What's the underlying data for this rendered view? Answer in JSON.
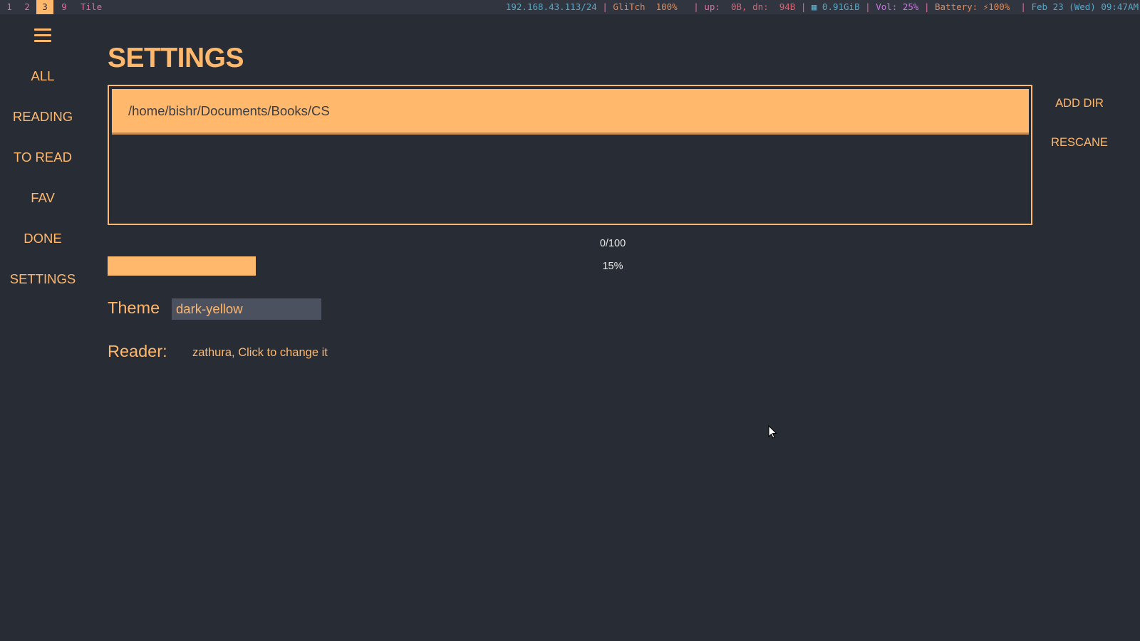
{
  "statusbar": {
    "workspaces": [
      {
        "label": "1",
        "active": false
      },
      {
        "label": "2",
        "active": false
      },
      {
        "label": "3",
        "active": true
      },
      {
        "label": "9",
        "active": false
      }
    ],
    "layout": "Tile",
    "segments": [
      {
        "text": "192.168.43.113/24 ",
        "color": "#56a8c8"
      },
      {
        "text": "| ",
        "color": "#e06c9a"
      },
      {
        "text": "GliTch  100%   ",
        "color": "#e08a5a"
      },
      {
        "text": "| up:  ",
        "color": "#e06c9a"
      },
      {
        "text": "0B, dn:  94B ",
        "color": "#e06070"
      },
      {
        "text": "| ",
        "color": "#e06c9a"
      },
      {
        "text": "▦ 0.91GiB ",
        "color": "#56a8c8"
      },
      {
        "text": "| ",
        "color": "#e06c9a"
      },
      {
        "text": "Vol: 25% ",
        "color": "#c678dd"
      },
      {
        "text": "| ",
        "color": "#e06c9a"
      },
      {
        "text": "Battery: ⚡100%  ",
        "color": "#e08a5a"
      },
      {
        "text": "| ",
        "color": "#e06c9a"
      },
      {
        "text": "Feb 23 (Wed) 09:47AM",
        "color": "#56a8c8"
      }
    ]
  },
  "sidebar": {
    "menu_icon": "hamburger-menu-icon",
    "items": [
      {
        "label": "ALL"
      },
      {
        "label": "READING"
      },
      {
        "label": "TO READ"
      },
      {
        "label": "FAV"
      },
      {
        "label": "DONE"
      },
      {
        "label": "SETTINGS"
      }
    ]
  },
  "main": {
    "title": "SETTINGS",
    "directories": [
      "/home/bishr/Documents/Books/CS"
    ],
    "add_dir_label": "ADD DIR",
    "rescan_label": "RESCANE",
    "progress": {
      "count_text": "0/100",
      "percent_text": "15%",
      "fraction": 0.16
    },
    "theme": {
      "label": "Theme",
      "value": "dark-yellow"
    },
    "reader": {
      "label": "Reader:",
      "value": "zathura, Click to change it"
    }
  },
  "colors": {
    "accent": "#ffb86c",
    "background": "#282c34",
    "statusbar_bg": "#303540",
    "select_bg": "#4c5160"
  }
}
